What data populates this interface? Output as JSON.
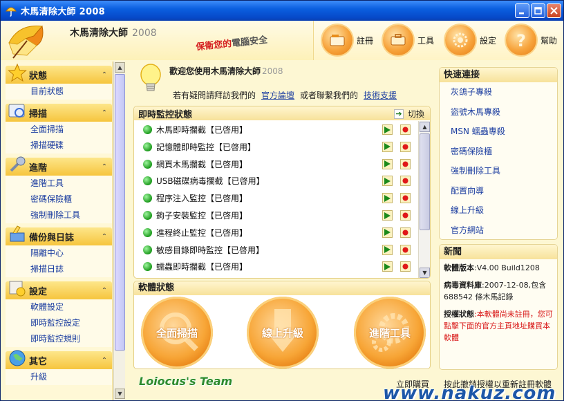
{
  "window": {
    "title": "木馬清除大師 2008"
  },
  "header": {
    "brand": "木馬清除大師",
    "brand_year": "2008",
    "slogan_a": "保衛您的",
    "slogan_b": "電腦安全",
    "tools": [
      {
        "label": "註冊",
        "icon": "register-icon"
      },
      {
        "label": "工具",
        "icon": "tools-icon"
      },
      {
        "label": "設定",
        "icon": "settings-icon"
      },
      {
        "label": "幫助",
        "icon": "help-icon"
      }
    ]
  },
  "sidebar": {
    "sections": [
      {
        "title": "狀態",
        "icon": "star-icon",
        "items": [
          "目前狀態"
        ]
      },
      {
        "title": "掃描",
        "icon": "scan-icon",
        "items": [
          "全面掃描",
          "掃描硬碟"
        ]
      },
      {
        "title": "進階",
        "icon": "wrench-icon",
        "items": [
          "進階工具",
          "密碼保險櫃",
          "強制刪除工具"
        ]
      },
      {
        "title": "備份與日誌",
        "icon": "backup-icon",
        "items": [
          "隔離中心",
          "掃描日誌"
        ]
      },
      {
        "title": "設定",
        "icon": "config-icon",
        "items": [
          "軟體設定",
          "即時監控設定",
          "即時監控規則"
        ]
      },
      {
        "title": "其它",
        "icon": "globe-icon",
        "items": [
          "升級"
        ]
      }
    ]
  },
  "welcome": {
    "title": "歡迎您使用木馬清除大師",
    "year": "2008",
    "line_pre": "若有疑問請拜訪我們的",
    "forum": "官方論壇",
    "line_mid": "或者聯繫我們的",
    "support": "技術支援"
  },
  "monitor": {
    "title": "即時監控狀態",
    "switch_label": "切換",
    "items": [
      "木馬即時攔截【已啓用】",
      "記憶體即時監控【已啓用】",
      "網頁木馬攔截【已啓用】",
      "USB磁碟病毒攔截【已啓用】",
      "程序注入監控【已啓用】",
      "鉤子安裝監控【已啓用】",
      "進程終止監控【已啓用】",
      "敏感目錄即時監控【已啓用】",
      "蠕蟲即時攔截【已啓用】"
    ]
  },
  "software": {
    "title": "軟體狀態",
    "buttons": [
      "全面掃描",
      "線上升級",
      "進階工具"
    ]
  },
  "quick": {
    "title": "快速連接",
    "links": [
      "灰鴿子專殺",
      "盜號木馬專殺",
      "MSN 蠕蟲專殺",
      "密碼保險櫃",
      "強制刪除工具",
      "配置向導",
      "線上升級",
      "官方網站"
    ]
  },
  "news": {
    "title": "新聞",
    "version_label": "軟體版本",
    "version_value": ":V4.00 Build1208",
    "db_label": "病毒資料庫",
    "db_value": ":2007-12-08,包含688542 條木馬記錄",
    "license_label": "授權狀態",
    "license_value": ":本軟體尚未註冊，您可點擊下面的官方主頁地址購買本軟體"
  },
  "footer": {
    "team": "Loiocus's Team",
    "buy": "立即購買",
    "license_link": "按此撤銷授權以重新註冊軟體",
    "watermark": "www.nakuz.com"
  }
}
